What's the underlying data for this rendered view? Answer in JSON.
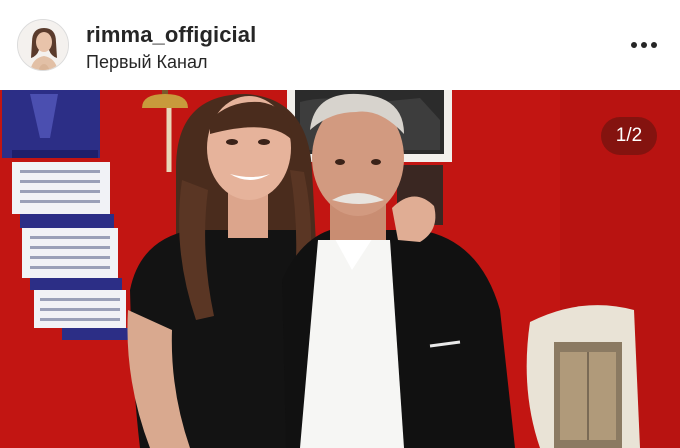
{
  "post": {
    "username": "rimma_offigicial",
    "location": "Первый Канал",
    "avatar_icon": "profile-avatar",
    "more_icon": "more-horizontal-icon",
    "counter": "1/2"
  },
  "colors": {
    "wall_red": "#c21512",
    "text": "#262626",
    "counter_bg": "#5a140f"
  }
}
